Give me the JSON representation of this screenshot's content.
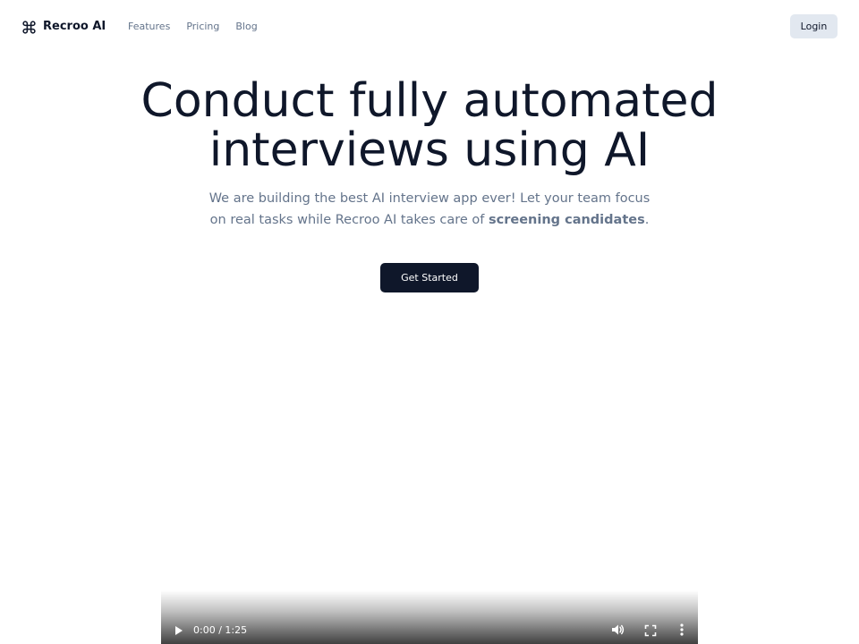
{
  "nav": {
    "brand_name": "Recroo AI",
    "brand_icon": "command-icon",
    "links": [
      "Features",
      "Pricing",
      "Blog"
    ],
    "login_label": "Login"
  },
  "hero": {
    "title_line1": "Conduct fully automated",
    "title_line2": "interviews using AI",
    "subtitle_pre": "We are building the best AI interview app ever! Let your team focus on real tasks while Recroo AI takes care of ",
    "subtitle_bold": "screening candidates",
    "subtitle_post": ".",
    "cta_label": "Get Started"
  },
  "video": {
    "time": "0:00 / 1:25",
    "icons": [
      "play-icon",
      "volume-icon",
      "fullscreen-icon",
      "more-options-icon"
    ]
  },
  "colors": {
    "primary": "#0f172a",
    "muted_text": "#64748b",
    "secondary_button": "#e2e8f0",
    "background": "#ffffff"
  }
}
